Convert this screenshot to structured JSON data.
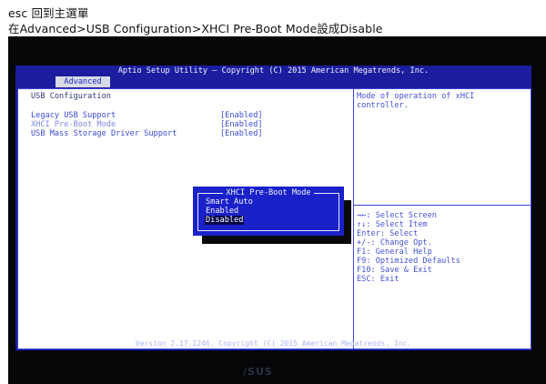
{
  "captions": {
    "line1": "esc 回到主選單",
    "line2": "在Advanced>USB Configuration>XHCI Pre-Boot Mode設成Disable"
  },
  "bios": {
    "title": "Aptio Setup Utility – Copyright (C) 2015 American Megatrends, Inc.",
    "active_tab": "Advanced",
    "section_title": "USB Configuration",
    "options": [
      {
        "label": "Legacy USB Support",
        "value": "[Enabled]"
      },
      {
        "label": "XHCI Pre-Boot Mode",
        "value": "[Enabled]"
      },
      {
        "label": "USB Mass Storage Driver Support",
        "value": "[Enabled]"
      }
    ],
    "help_text": [
      "Mode of operation of xHCI",
      "controller."
    ],
    "key_help": [
      "→←: Select Screen",
      "↑↓: Select Item",
      "Enter: Select",
      "+/-: Change Opt.",
      "F1: General Help",
      "F9: Optimized Defaults",
      "F10: Save & Exit",
      "ESC: Exit"
    ],
    "popup": {
      "title": "XHCI Pre-Boot Mode",
      "options": [
        "Smart Auto",
        "Enabled",
        "Disabled"
      ],
      "selected": "Disabled"
    },
    "footer": "Version 2.17.1246. Copyright (C) 2015 American Megatrends, Inc."
  },
  "monitor_logo": "/SUS"
}
